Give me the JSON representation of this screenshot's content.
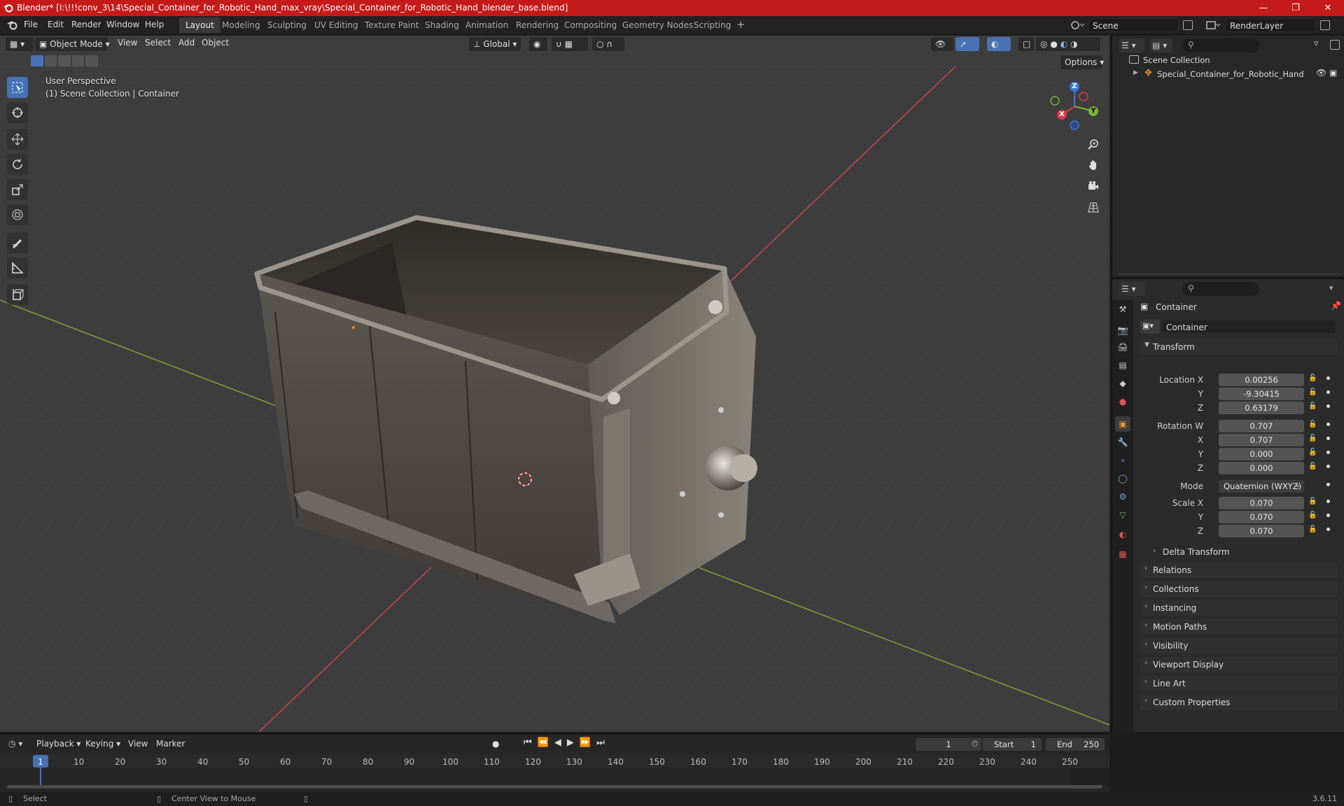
{
  "window": {
    "title": "Blender* [I:\\!!!conv_3\\14\\Special_Container_for_Robotic_Hand_max_vray\\Special_Container_for_Robotic_Hand_blender_base.blend]"
  },
  "menu": [
    "File",
    "Edit",
    "Render",
    "Window",
    "Help"
  ],
  "workspaces": [
    "Layout",
    "Modeling",
    "Sculpting",
    "UV Editing",
    "Texture Paint",
    "Shading",
    "Animation",
    "Rendering",
    "Compositing",
    "Geometry Nodes",
    "Scripting"
  ],
  "active_workspace": "Layout",
  "scene_field": "Scene",
  "renderlayer_field": "RenderLayer",
  "viewport": {
    "mode": "Object Mode",
    "menus": [
      "View",
      "Select",
      "Add",
      "Object"
    ],
    "transform_orientation": "Global",
    "options": "Options",
    "perspective_label": "User Perspective",
    "collection_label": "(1) Scene Collection | Container",
    "gizmo": {
      "z": "Z",
      "y": "Y",
      "x": "X"
    },
    "colors": {
      "grid_bg": "#3d3d3d",
      "x_axis": "#c8474b",
      "y_axis": "#7ea238",
      "active_tool": "#4772b3"
    }
  },
  "outliner": {
    "scene_collection": "Scene Collection",
    "object": "Special_Container_for_Robotic_Hand"
  },
  "properties": {
    "breadcrumb": "Container",
    "object_name": "Container",
    "transform_header": "Transform",
    "location": {
      "label": "Location X",
      "x": "0.00256",
      "y": "-9.30415",
      "z": "0.63179"
    },
    "rotation": {
      "label": "Rotation W",
      "w": "0.707",
      "x": "0.707",
      "y": "0.000",
      "z": "0.000"
    },
    "mode_label": "Mode",
    "mode_value": "Quaternion (WXYZ)",
    "scale": {
      "label": "Scale X",
      "x": "0.070",
      "y": "0.070",
      "z": "0.070"
    },
    "axis": {
      "y": "Y",
      "z": "Z",
      "x": "X"
    },
    "delta_transform": "Delta Transform",
    "panels": [
      "Relations",
      "Collections",
      "Instancing",
      "Motion Paths",
      "Visibility",
      "Viewport Display",
      "Line Art",
      "Custom Properties"
    ]
  },
  "timeline": {
    "menus": [
      "Playback",
      "Keying",
      "View",
      "Marker"
    ],
    "current_frame": "1",
    "start_label": "Start",
    "start": "1",
    "end_label": "End",
    "end": "250",
    "ruler": [
      "1",
      "10",
      "20",
      "30",
      "40",
      "50",
      "60",
      "70",
      "80",
      "90",
      "100",
      "110",
      "120",
      "130",
      "140",
      "150",
      "160",
      "170",
      "180",
      "190",
      "200",
      "210",
      "220",
      "230",
      "240",
      "250"
    ]
  },
  "status": {
    "left": "Select",
    "middle": "Center View to Mouse",
    "version": "3.6.11"
  }
}
